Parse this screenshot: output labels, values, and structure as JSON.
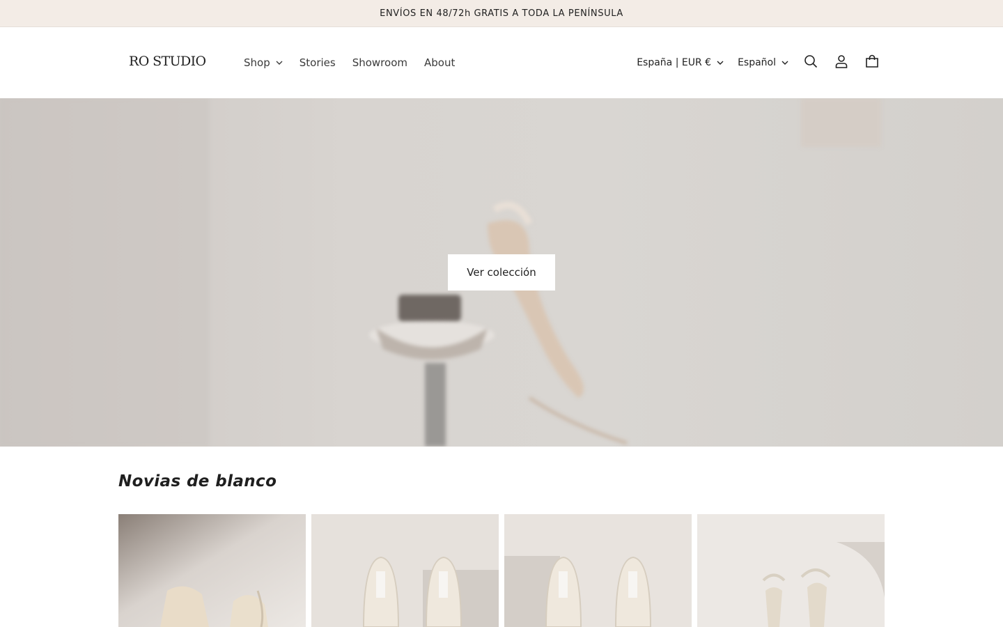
{
  "announcement": {
    "text": "ENVÍOS EN 48/72h GRATIS A TODA LA PENÍNSULA"
  },
  "header": {
    "logo": "RO STUDIO",
    "nav": [
      {
        "label": "Shop",
        "has_dropdown": true
      },
      {
        "label": "Stories",
        "has_dropdown": false
      },
      {
        "label": "Showroom",
        "has_dropdown": false
      },
      {
        "label": "About",
        "has_dropdown": false
      }
    ],
    "country_selector": "España | EUR €",
    "language_selector": "Español",
    "icons": {
      "search": "search-icon",
      "account": "account-icon",
      "cart": "cart-icon"
    }
  },
  "hero": {
    "cta_label": "Ver colección"
  },
  "collection": {
    "title": "Novias de blanco",
    "products": [
      {
        "image": "slingback-heels"
      },
      {
        "image": "mules-top-view"
      },
      {
        "image": "mules-top-view"
      },
      {
        "image": "ankle-strap-sandals"
      }
    ]
  },
  "colors": {
    "announcement_bg": "#f3ece6",
    "text": "#1f1f1f",
    "hero_bg": "#d8d4d0"
  }
}
